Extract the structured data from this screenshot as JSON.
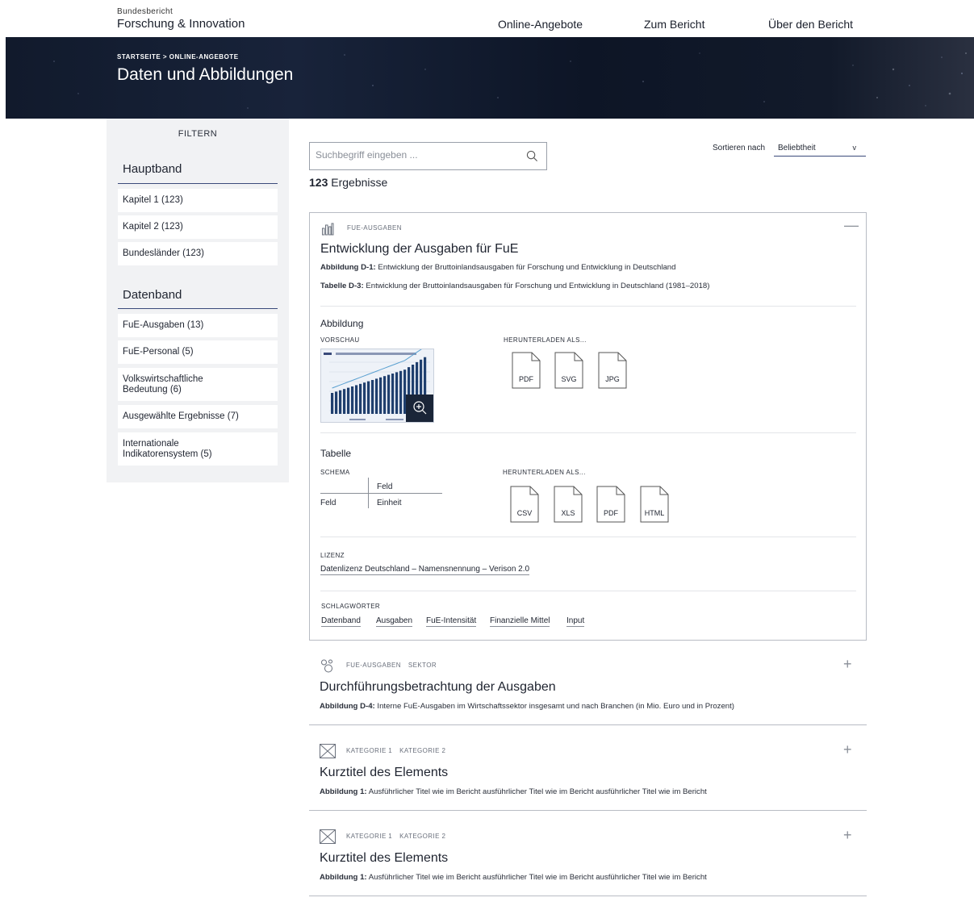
{
  "header": {
    "brand_sup": "Bundesbericht",
    "brand_main": "Forschung & Innovation",
    "nav": [
      "Online-Angebote",
      "Zum Bericht",
      "Über den Bericht"
    ]
  },
  "hero": {
    "breadcrumb": "STARTSEITE  >  ONLINE-ANGEBOTE",
    "title": "Daten und Abbildungen"
  },
  "sidebar": {
    "title": "FILTERN",
    "groups": [
      {
        "title": "Hauptband",
        "items": [
          "Kapitel 1 (123)",
          "Kapitel 2 (123)",
          "Bundesländer (123)"
        ]
      },
      {
        "title": "Datenband",
        "items": [
          "FuE-Ausgaben (13)",
          "FuE-Personal (5)",
          "Volkswirtschaftliche Bedeutung (6)",
          "Ausgewählte Ergebnisse (7)",
          "Internationale Indikatorensystem (5)"
        ]
      }
    ]
  },
  "search": {
    "placeholder": "Suchbegriff eingeben ...",
    "value": ""
  },
  "sort": {
    "label": "Sortieren nach",
    "value": "Beliebtheit"
  },
  "results": {
    "count": "123",
    "label": "Ergebnisse"
  },
  "cards": [
    {
      "tags": [
        "FUE-AUSGABEN"
      ],
      "title": "Entwicklung der Ausgaben für FuE",
      "lines": [
        {
          "prefix": "Abbildung D-1:",
          "text": " Entwicklung der Bruttoinlandsausgaben für Forschung und Entwicklung in Deutschland"
        },
        {
          "prefix": "Tabelle D-3:",
          "text": " Entwicklung der Bruttoinlandsausgaben für Forschung und Entwicklung in Deutschland (1981–2018)"
        }
      ],
      "toggle": "—",
      "figure": {
        "title": "Abbildung",
        "preview_label": "VORSCHAU",
        "download_label": "HERUNTERLADEN ALS...",
        "formats": [
          "PDF",
          "SVG",
          "JPG"
        ]
      },
      "table": {
        "title": "Tabelle",
        "schema_label": "SCHEMA",
        "schema": {
          "col": "Feld",
          "row": "Feld",
          "cell": "Einheit"
        },
        "download_label": "HERUNTERLADEN ALS...",
        "formats": [
          "CSV",
          "XLS",
          "PDF",
          "HTML"
        ]
      },
      "license": {
        "label": "LIZENZ",
        "link": "Datenlizenz Deutschland – Namensnennung – Verison 2.0"
      },
      "keywords": {
        "label": "SCHLAGWÖRTER",
        "items": [
          "Datenband",
          "Ausgaben",
          "FuE-Intensität",
          "Finanzielle Mittel",
          "Input"
        ]
      }
    },
    {
      "tags": [
        "FUE-AUSGABEN",
        "SEKTOR"
      ],
      "title": "Durchführungsbetrachtung der Ausgaben",
      "lines": [
        {
          "prefix": "Abbildung D-4:",
          "text": " Interne FuE-Ausgaben im Wirtschaftssektor insgesamt und nach Branchen (in Mio. Euro und in Prozent)"
        }
      ],
      "toggle": "+"
    },
    {
      "tags": [
        "KATEGORIE 1",
        "KATEGORIE 2"
      ],
      "title": "Kurztitel des Elements",
      "lines": [
        {
          "prefix": "Abbildung 1:",
          "text": " Ausführlicher Titel wie im Bericht ausführlicher Titel wie im Bericht ausführlicher Titel wie im Bericht"
        }
      ],
      "toggle": "+"
    },
    {
      "tags": [
        "KATEGORIE 1",
        "KATEGORIE 2"
      ],
      "title": "Kurztitel des Elements",
      "lines": [
        {
          "prefix": "Abbildung 1:",
          "text": " Ausführlicher Titel wie im Bericht ausführlicher Titel wie im Bericht ausführlicher Titel wie im Bericht"
        }
      ],
      "toggle": "+"
    }
  ],
  "colors": {
    "accent": "#3a4a7a",
    "hero": "#121a2c",
    "sidebar_bg": "#f1f2f4"
  }
}
